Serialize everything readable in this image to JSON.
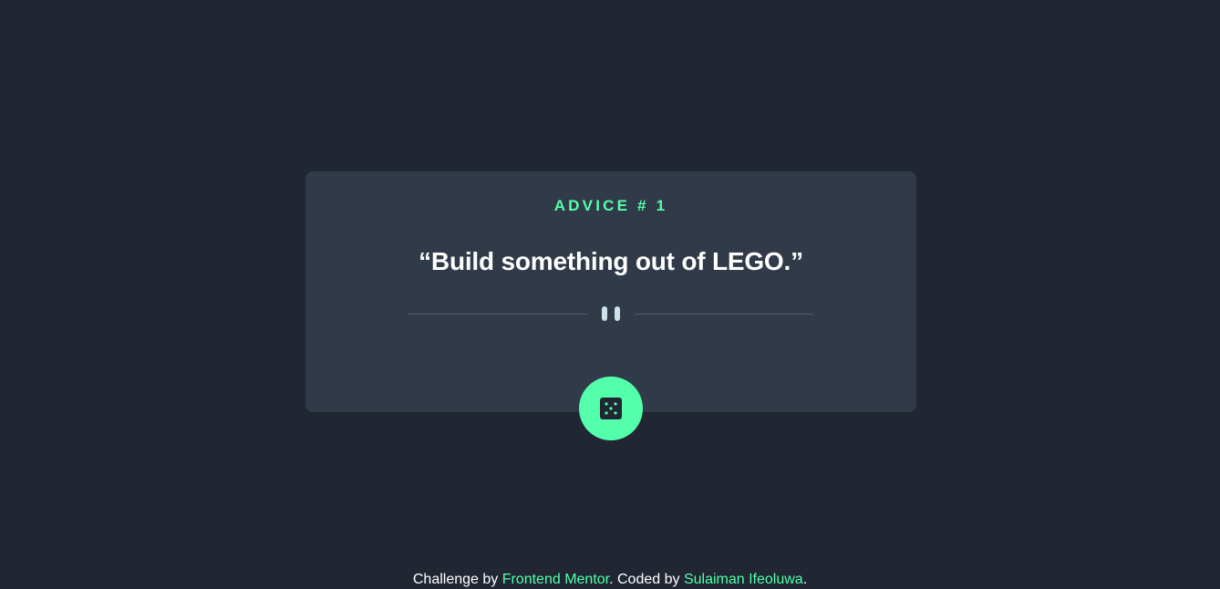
{
  "card": {
    "advice_id": "ADVICE # 1",
    "quote": "“Build something out of LEGO.”"
  },
  "dice_button": {
    "icon": "dice-icon",
    "color": "#53FFAA"
  },
  "footer": {
    "prefix": "Challenge by ",
    "challenge_link": "Frontend Mentor",
    "middle": ". Coded by ",
    "author_link": "Sulaiman Ifeoluwa",
    "suffix": "."
  },
  "colors": {
    "background": "#202632",
    "card": "#313A48",
    "accent": "#53FFAA",
    "divider": "#4F5D74",
    "pause_icon": "#CEE3E9",
    "text": "#FFFFFF"
  }
}
